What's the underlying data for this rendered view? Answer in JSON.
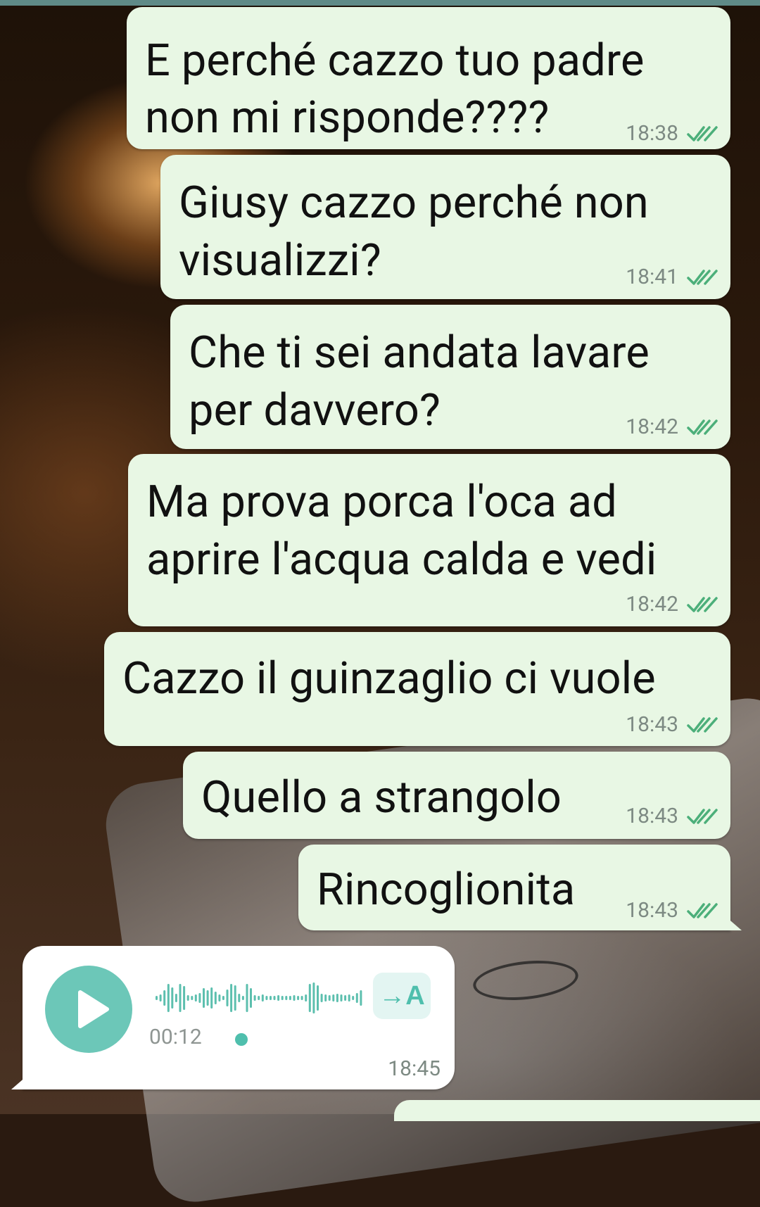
{
  "chat": {
    "outgoing": [
      {
        "lines": [
          "E perché cazzo tuo padre",
          "non mi risponde????"
        ],
        "time": "18:38"
      },
      {
        "lines": [
          "Giusy cazzo perché non",
          "visualizzi?"
        ],
        "time": "18:41"
      },
      {
        "lines": [
          "Che ti sei andata lavare",
          "per davvero?"
        ],
        "time": "18:42"
      },
      {
        "lines": [
          "Ma prova porca l'oca ad",
          "aprire l'acqua calda e vedi"
        ],
        "time": "18:42"
      },
      {
        "lines": [
          "Cazzo il guinzaglio ci vuole"
        ],
        "time": "18:43"
      },
      {
        "lines": [
          "Quello a strangolo"
        ],
        "time": "18:43"
      },
      {
        "lines": [
          "Rincoglionita"
        ],
        "time": "18:43"
      }
    ],
    "voice_message": {
      "duration": "00:12",
      "time": "18:45",
      "transcribe_label": "→A",
      "icons": [
        "play-icon"
      ]
    }
  },
  "colors": {
    "outgoing_bubble": "#e8f7e4",
    "incoming_bubble": "#ffffff",
    "accent": "#6cc7b8",
    "read_ticks": "#4caf7a"
  }
}
